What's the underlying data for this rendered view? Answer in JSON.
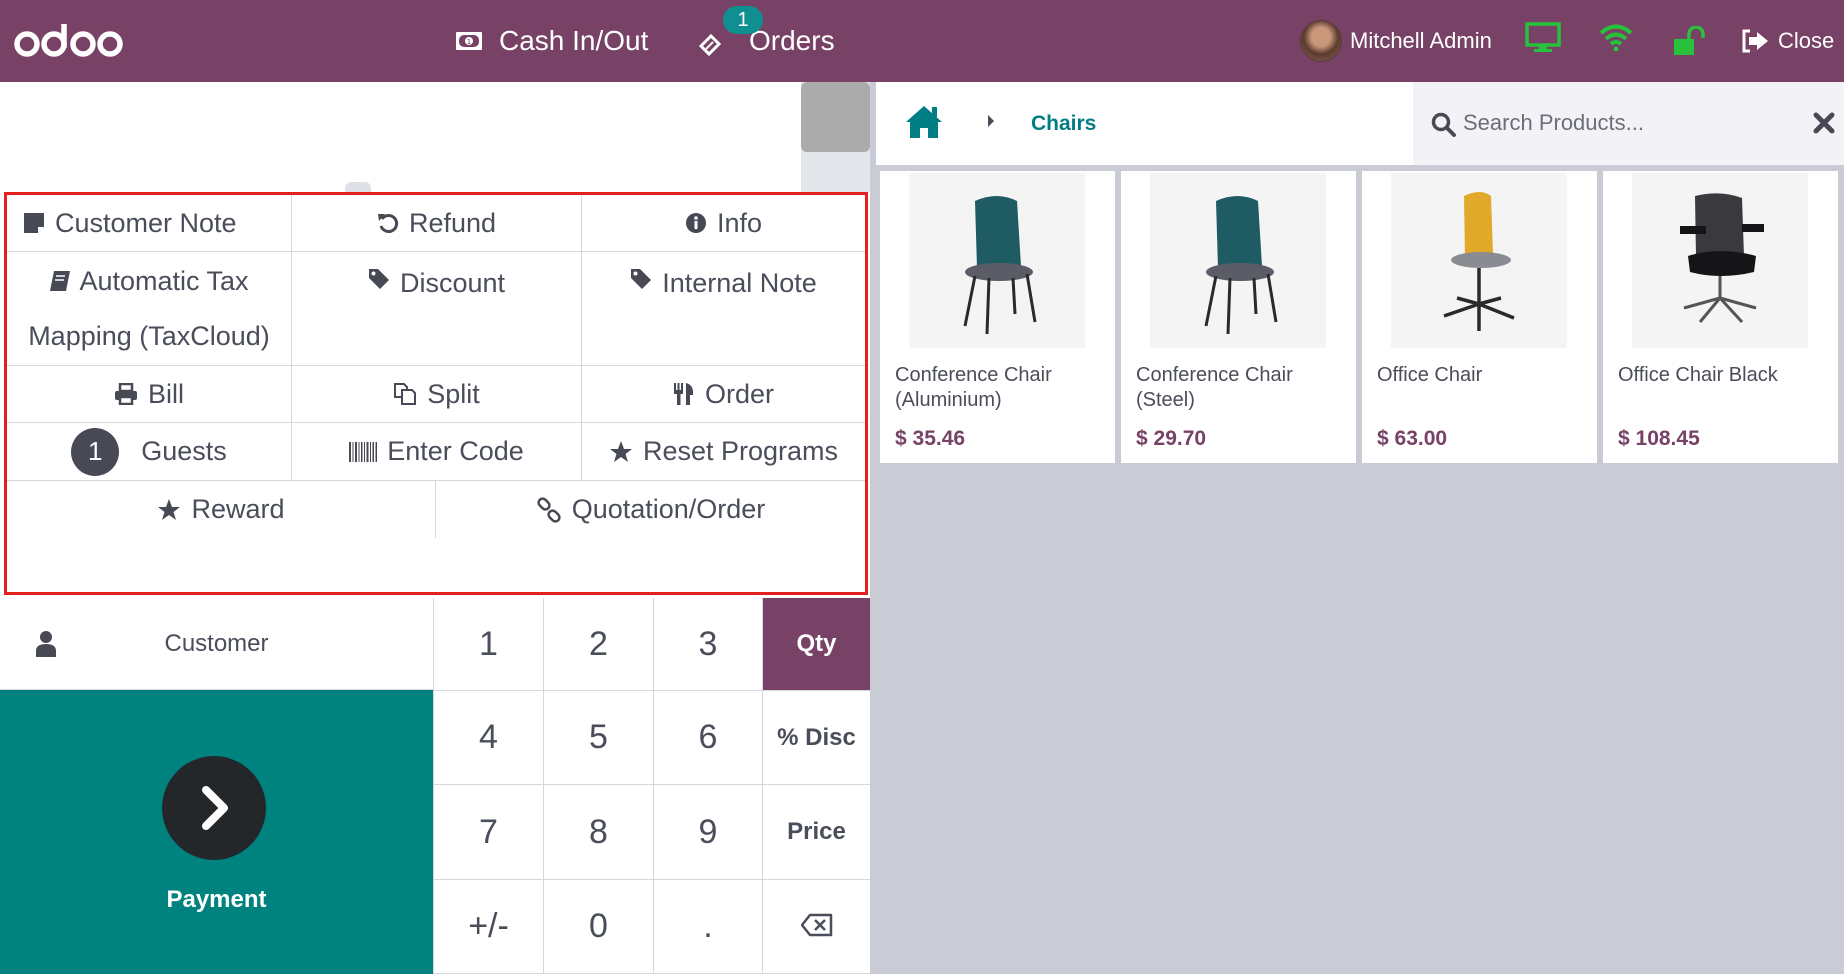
{
  "header": {
    "logo_text": "odoo",
    "cash_label": "Cash In/Out",
    "orders_label": "Orders",
    "orders_badge": "1",
    "user_name": "Mitchell Admin",
    "close_label": "Close",
    "colors": {
      "brand": "#784266",
      "status_ok": "#28c13c",
      "badge": "#0f8f8f"
    }
  },
  "actions": {
    "rows": [
      [
        {
          "label": "Customer Note",
          "icon": "note-icon"
        },
        {
          "label": "Refund",
          "icon": "undo-icon"
        },
        {
          "label": "Info",
          "icon": "info-icon"
        }
      ],
      [
        {
          "label_line1": "Automatic Tax",
          "label_line2": "Mapping (TaxCloud)",
          "icon": "book-icon"
        },
        {
          "label": "Discount",
          "icon": "tag-icon"
        },
        {
          "label": "Internal Note",
          "icon": "tag-icon"
        }
      ],
      [
        {
          "label": "Bill",
          "icon": "printer-icon"
        },
        {
          "label": "Split",
          "icon": "copy-icon"
        },
        {
          "label": "Order",
          "icon": "cutlery-icon"
        }
      ],
      [
        {
          "label": "Guests",
          "count": "1"
        },
        {
          "label": "Enter Code",
          "icon": "barcode-icon"
        },
        {
          "label": "Reset Programs",
          "icon": "star-icon"
        }
      ],
      [
        {
          "label": "Reward",
          "icon": "star-icon"
        },
        {
          "label": "Quotation/Order",
          "icon": "link-icon"
        }
      ]
    ]
  },
  "customer_label": "Customer",
  "payment_label": "Payment",
  "numpad": {
    "keys": [
      "1",
      "2",
      "3",
      "Qty",
      "4",
      "5",
      "6",
      "% Disc",
      "7",
      "8",
      "9",
      "Price",
      "+/-",
      "0",
      "."
    ],
    "active_mode": "Qty"
  },
  "breadcrumb": {
    "current": "Chairs"
  },
  "search": {
    "placeholder": "Search Products..."
  },
  "products": [
    {
      "name": "Conference Chair (Aluminium)",
      "price": "$ 35.46"
    },
    {
      "name": "Conference Chair (Steel)",
      "price": "$ 29.70"
    },
    {
      "name": "Office Chair",
      "price": "$ 63.00"
    },
    {
      "name": "Office Chair Black",
      "price": "$ 108.45"
    }
  ]
}
